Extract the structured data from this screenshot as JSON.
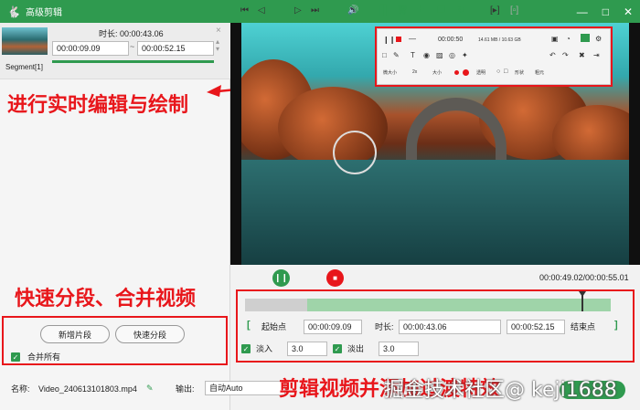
{
  "app": {
    "title": "高级剪辑"
  },
  "segment": {
    "duration_label": "时长:",
    "duration": "00:00:43.06",
    "start": "00:00:09.09",
    "end": "00:00:52.15",
    "tilde": "~",
    "label": "Segment[1]",
    "close_glyph": "×"
  },
  "annotations": {
    "realtime_edit": "进行实时编辑与绘制",
    "split_merge": "快速分段、合并视频",
    "cut_fade": "剪辑视频并添加过渡特效"
  },
  "left_actions": {
    "new_segment": "新增片段",
    "quick_split": "快速分段",
    "merge_all": "合并所有"
  },
  "recorder_panel": {
    "time": "00:00:50",
    "size": "14.61 MB / 10.63 GB",
    "label_a": "微大小",
    "value_a": "2x",
    "label_b": "大小",
    "label_c": "透明",
    "label_d": "形状",
    "label_e": "粗元"
  },
  "player": {
    "time_readout": "00:00:49.02/00:00:55.01"
  },
  "trim": {
    "start_label": "起始点",
    "start": "00:00:09.09",
    "duration_label": "时长:",
    "duration": "00:00:43.06",
    "end": "00:00:52.15",
    "end_label": "结束点",
    "fade_in_label": "淡入",
    "fade_in": "3.0",
    "fade_out_label": "淡出",
    "fade_out": "3.0"
  },
  "bottom": {
    "name_label": "名称:",
    "filename": "Video_240613101803.mp4",
    "output_label": "输出:",
    "output_value": "自动Auto"
  },
  "watermark": "掘金技术社区@ keji1688",
  "playback": {
    "playhead_fraction": 0.92
  },
  "colors": {
    "accent": "#2f9a4f",
    "annotation": "#e8161b"
  }
}
